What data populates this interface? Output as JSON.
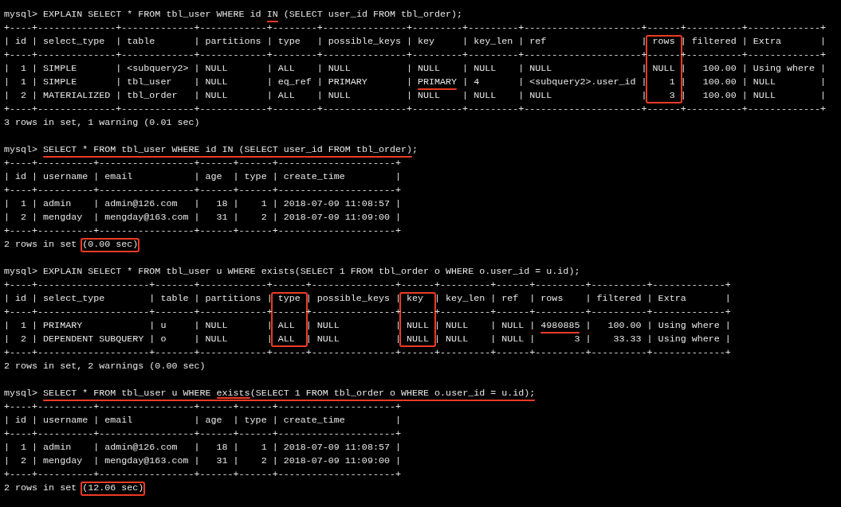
{
  "blocks": [
    {
      "lines": [
        [
          "mysql> EXPLAIN SELECT * FROM tbl_user WHERE id ",
          {
            "text": "IN",
            "underlined": true
          },
          " (SELECT user_id FROM tbl_order);"
        ],
        [
          "+----+--------------+-------------+------------+--------+---------------+---------+---------+---------------------+------+----------+-------------+"
        ],
        [
          "| id | select_type  | table       | partitions | type   | possible_keys | key     | key_len | ref                 |",
          {
            "text": " rows ",
            "column_boxed": true
          },
          "| filtered | Extra       |"
        ],
        [
          "+----+--------------+-------------+------------+--------+---------------+---------+---------+---------------------+",
          {
            "text": "------",
            "column_boxed": true
          },
          "+----------+-------------+"
        ],
        [
          "|  1 | SIMPLE       | <subquery2> | NULL       | ALL    | NULL          | NULL    | NULL    | NULL                |",
          {
            "text": " NULL ",
            "column_boxed": true
          },
          "|   100.00 | Using where |"
        ],
        [
          "|  1 | SIMPLE       | tbl_user    | NULL       | eq_ref | PRIMARY       | ",
          {
            "text": "PRIMARY",
            "underlined": true
          },
          " | 4       | <subquery2>.user_id |",
          {
            "text": "    1 ",
            "column_boxed": true
          },
          "|   100.00 | NULL        |"
        ],
        [
          "|  2 | MATERIALIZED | tbl_order   | NULL       | ALL    | NULL          | NULL    | NULL    | NULL                |",
          {
            "text": "    3 ",
            "column_boxed": true
          },
          "|   100.00 | NULL        |"
        ],
        [
          "+----+--------------+-------------+------------+--------+---------------+---------+---------+---------------------+------+----------+-------------+"
        ],
        [
          "3 rows in set, 1 warning (0.01 sec)"
        ]
      ]
    },
    {
      "lines": [
        [
          "mysql> ",
          {
            "text": "SELECT * FROM tbl_user WHERE id IN (SELECT user_id FROM tbl_order)",
            "underlined": true
          },
          ";"
        ],
        [
          "+----+----------+-----------------+------+------+---------------------+"
        ],
        [
          "| id | username | email           | age  | type | create_time         |"
        ],
        [
          "+----+----------+-----------------+------+------+---------------------+"
        ],
        [
          "|  1 | admin    | admin@126.com   |   18 |    1 | 2018-07-09 11:08:57 |"
        ],
        [
          "|  2 | mengday  | mengday@163.com |   31 |    2 | 2018-07-09 11:09:00 |"
        ],
        [
          "+----+----------+-----------------+------+------+---------------------+"
        ],
        [
          "2 rows in set ",
          {
            "text": "(0.00 sec)",
            "boxed": true
          }
        ]
      ]
    },
    {
      "lines": [
        [
          "mysql> EXPLAIN SELECT * FROM tbl_user u WHERE exists(SELECT 1 FROM tbl_order o WHERE o.user_id = u.id);"
        ],
        [
          "+----+--------------------+-------+------------+------+---------------+------+---------+------+---------+----------+-------------+"
        ],
        [
          "| id | select_type        | table | partitions |",
          {
            "text": " type ",
            "column_boxed": true
          },
          "| possible_keys |",
          {
            "text": " key  ",
            "column_boxed": true
          },
          "| key_len | ref  | rows    | filtered | Extra       |"
        ],
        [
          "+----+--------------------+-------+------------+",
          {
            "text": "------",
            "column_boxed": true
          },
          "+---------------+",
          {
            "text": "------",
            "column_boxed": true
          },
          "+---------+------+---------+----------+-------------+"
        ],
        [
          "|  1 | PRIMARY            | u     | NULL       |",
          {
            "text": " ALL  ",
            "column_boxed": true
          },
          "| NULL          |",
          {
            "text": " NULL ",
            "column_boxed": true
          },
          "| NULL    | NULL | ",
          {
            "text": "4980885",
            "underlined": true
          },
          " |   100.00 | Using where |"
        ],
        [
          "|  2 | DEPENDENT SUBQUERY | o     | NULL       |",
          {
            "text": " ALL  ",
            "column_boxed": true
          },
          "| NULL          |",
          {
            "text": " NULL ",
            "column_boxed": true
          },
          "| NULL    | NULL |       3 |    33.33 | Using where |"
        ],
        [
          "+----+--------------------+-------+------------+------+---------------+------+---------+------+---------+----------+-------------+"
        ],
        [
          "2 rows in set, 2 warnings (0.00 sec)"
        ]
      ]
    },
    {
      "lines": [
        [
          "mysql> ",
          {
            "text": "SELECT * FROM tbl_user u WHERE ",
            "underlined": true
          },
          {
            "text": "exists",
            "underlined": true,
            "double_underlined": true
          },
          {
            "text": "(SELECT 1 FROM tbl_order o WHERE o.user_id = u.id);",
            "underlined": true
          }
        ],
        [
          "+----+----------+-----------------+------+------+---------------------+"
        ],
        [
          "| id | username | email           | age  | type | create_time         |"
        ],
        [
          "+----+----------+-----------------+------+------+---------------------+"
        ],
        [
          "|  1 | admin    | admin@126.com   |   18 |    1 | 2018-07-09 11:08:57 |"
        ],
        [
          "|  2 | mengday  | mengday@163.com |   31 |    2 | 2018-07-09 11:09:00 |"
        ],
        [
          "+----+----------+-----------------+------+------+---------------------+"
        ],
        [
          "2 rows in set ",
          {
            "text": "(12.06 sec)",
            "boxed": true
          }
        ]
      ]
    }
  ]
}
